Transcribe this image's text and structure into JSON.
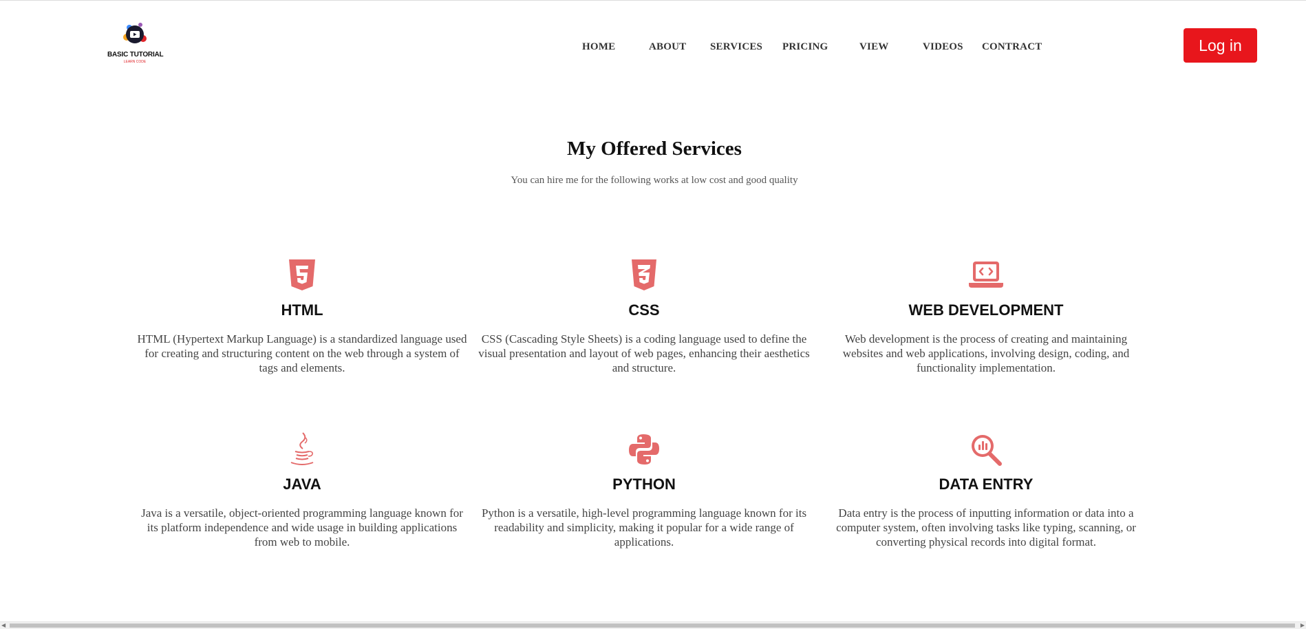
{
  "header": {
    "logo": {
      "title": "BASIC TUTORIAL",
      "subtitle": "LEARN CODE"
    },
    "nav": [
      "HOME",
      "ABOUT",
      "SERVICES",
      "PRICING",
      "VIEW",
      "VIDEOS",
      "CONTRACT"
    ],
    "login_label": "Log in"
  },
  "section": {
    "title": "My Offered Services",
    "subtitle": "You can hire me for the following works at low cost and good quality"
  },
  "services": [
    {
      "icon": "html5-icon",
      "title": "HTML",
      "text": "HTML (Hypertext Markup Language) is a standardized language used for creating and structuring content on the web through a system of tags and elements."
    },
    {
      "icon": "css3-icon",
      "title": "CSS",
      "text": "CSS (Cascading Style Sheets) is a coding language used to define the visual presentation and layout of web pages, enhancing their aesthetics and structure."
    },
    {
      "icon": "laptop-code-icon",
      "title": "WEB DEVELOPMENT",
      "text": "Web development is the process of creating and maintaining websites and web applications, involving design, coding, and functionality implementation."
    },
    {
      "icon": "java-icon",
      "title": "JAVA",
      "text": "Java is a versatile, object-oriented programming language known for its platform independence and wide usage in building applications from web to mobile."
    },
    {
      "icon": "python-icon",
      "title": "PYTHON",
      "text": "Python is a versatile, high-level programming language known for its readability and simplicity, making it popular for a wide range of applications."
    },
    {
      "icon": "magnifier-chart-icon",
      "title": "DATA ENTRY",
      "text": "Data entry is the process of inputting information or data into a computer system, often involving tasks like typing, scanning, or converting physical records into digital format."
    }
  ],
  "colors": {
    "accent": "#e8161c",
    "icon": "#e46a6a",
    "text": "#444444",
    "heading": "#111111"
  }
}
